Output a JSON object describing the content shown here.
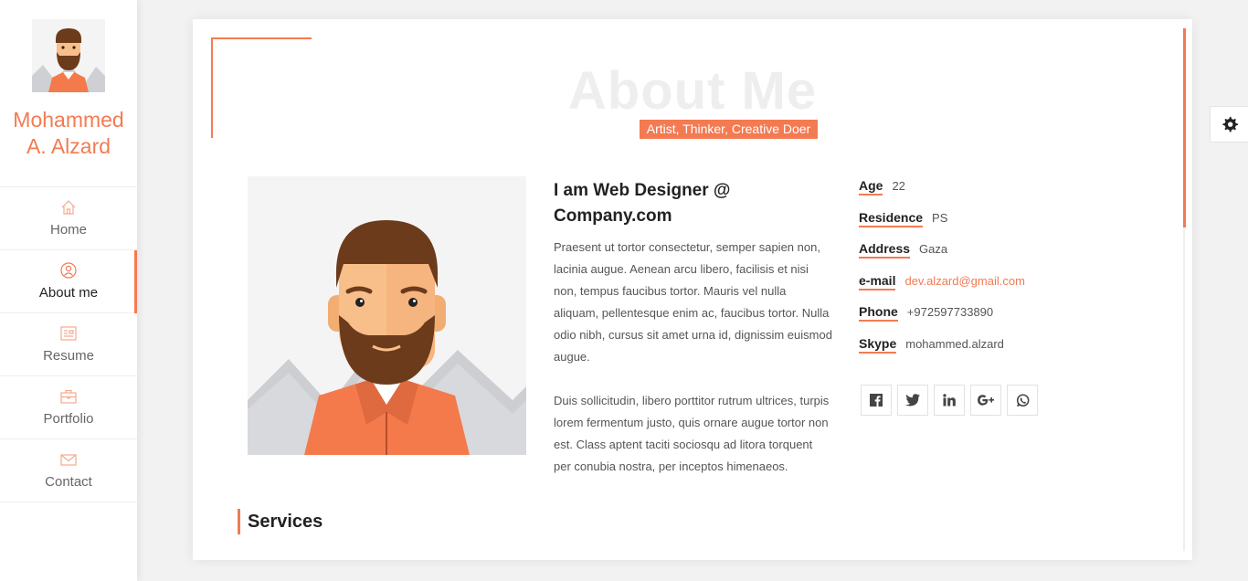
{
  "profile": {
    "name_line1": "Mohammed",
    "name_line2": "A. Alzard"
  },
  "nav": [
    {
      "label": "Home",
      "icon": "home-icon"
    },
    {
      "label": "About me",
      "icon": "user-icon",
      "active": true
    },
    {
      "label": "Resume",
      "icon": "resume-icon"
    },
    {
      "label": "Portfolio",
      "icon": "briefcase-icon"
    },
    {
      "label": "Contact",
      "icon": "envelope-icon"
    }
  ],
  "settings": {
    "icon": "gear-icon"
  },
  "about": {
    "title": "About Me",
    "tagline": "Artist, Thinker, Creative Doer",
    "intro_title": "I am Web Designer @ Company.com",
    "paragraph1": "Praesent ut tortor consectetur, semper sapien non, lacinia augue. Aenean arcu libero, facilisis et nisi non, tempus faucibus tortor. Mauris vel nulla aliquam, pellentesque enim ac, faucibus tortor. Nulla odio nibh, cursus sit amet urna id, dignissim euismod augue.",
    "paragraph2": "Duis sollicitudin, libero porttitor rutrum ultrices, turpis lorem fermentum justo, quis ornare augue tortor non est. Class aptent taciti sociosqu ad litora torquent per conubia nostra, per inceptos himenaeos."
  },
  "info": [
    {
      "label": "Age",
      "value": "22"
    },
    {
      "label": "Residence",
      "value": "PS"
    },
    {
      "label": "Address",
      "value": "Gaza"
    },
    {
      "label": "e-mail",
      "value": "dev.alzard@gmail.com",
      "link": true
    },
    {
      "label": "Phone",
      "value": "+972597733890"
    },
    {
      "label": "Skype",
      "value": "mohammed.alzard"
    }
  ],
  "social": [
    {
      "name": "facebook-icon",
      "glyph": "f"
    },
    {
      "name": "twitter-icon",
      "glyph": "t"
    },
    {
      "name": "linkedin-icon",
      "glyph": "in"
    },
    {
      "name": "google-plus-icon",
      "glyph": "G+"
    },
    {
      "name": "whatsapp-icon",
      "glyph": "w"
    }
  ],
  "services": {
    "title": "Services"
  },
  "colors": {
    "accent": "#f47a52",
    "title_ghost": "#eeeeee"
  }
}
